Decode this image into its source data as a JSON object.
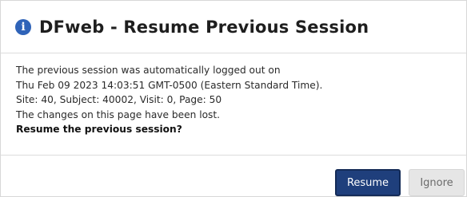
{
  "dialog": {
    "title": "DFweb - Resume Previous Session",
    "icon": "info-icon",
    "accent_color": "#2f63b8",
    "message_lines": [
      "The previous session was automatically logged out on",
      "Thu Feb 09 2023 14:03:51 GMT-0500 (Eastern Standard Time).",
      "Site: 40, Subject: 40002, Visit: 0, Page: 50",
      "The changes on this page have been lost."
    ],
    "prompt": "Resume the previous session?",
    "buttons": {
      "resume_label": "Resume",
      "ignore_label": "Ignore"
    }
  }
}
